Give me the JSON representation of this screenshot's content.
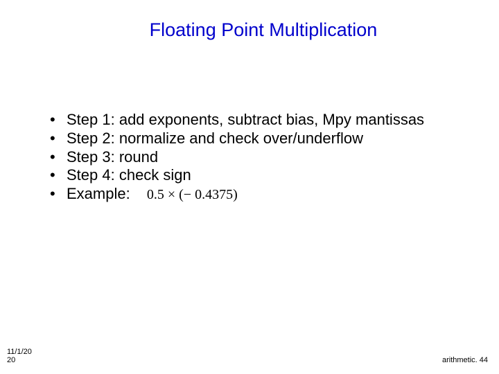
{
  "title": "Floating Point Multiplication",
  "bullets": [
    {
      "text": "Step 1: add exponents, subtract  bias, Mpy mantissas"
    },
    {
      "text": "Step 2: normalize and check over/underflow"
    },
    {
      "text": "Step 3: round"
    },
    {
      "text": "Step 4: check sign"
    },
    {
      "text": "Example:",
      "formula": "0.5 × (− 0.4375)"
    }
  ],
  "footer": {
    "date_line1": "11/1/20",
    "date_line2": "20",
    "right": "arithmetic. 44"
  }
}
